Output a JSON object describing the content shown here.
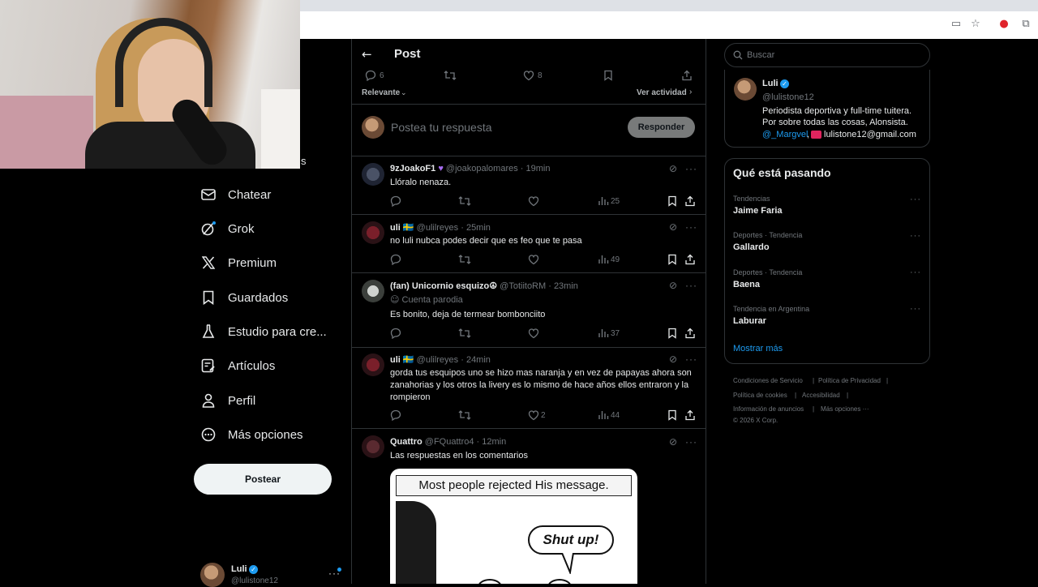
{
  "webcam_label": "s",
  "left_nav": {
    "items": [
      {
        "label": "Chatear",
        "icon": "mail-icon"
      },
      {
        "label": "Grok",
        "icon": "grok-icon"
      },
      {
        "label": "Premium",
        "icon": "x-logo-icon"
      },
      {
        "label": "Guardados",
        "icon": "bookmark-icon"
      },
      {
        "label": "Estudio para cre...",
        "icon": "flask-icon"
      },
      {
        "label": "Artículos",
        "icon": "article-icon"
      },
      {
        "label": "Perfil",
        "icon": "person-icon"
      },
      {
        "label": "Más opciones",
        "icon": "more-circle-icon"
      }
    ],
    "post_button": "Postear",
    "account": {
      "name": "Luli",
      "handle": "@lulistone12"
    }
  },
  "header": {
    "title": "Post"
  },
  "main_actions": {
    "replies": "6",
    "likes": "8"
  },
  "sort": {
    "label": "Relevante",
    "activity": "Ver actividad"
  },
  "composer": {
    "placeholder": "Postea tu respuesta",
    "button": "Responder"
  },
  "replies": [
    {
      "name": "9zJoakoF1",
      "handle": "@joakopalomares · 19min",
      "text": "Llóralo nenaza.",
      "retweets": "",
      "likes": "",
      "views": "25"
    },
    {
      "name": "uli 🇸🇪",
      "handle": "@ulilreyes · 25min",
      "text": "no luli nubca podes decir que es feo que te pasa",
      "retweets": "",
      "likes": "",
      "views": "49"
    },
    {
      "name": "(fan) Unicornio esquizo☮",
      "handle": "@TotiitoRM · 23min",
      "parody": "Cuenta parodia",
      "text": "Es bonito, deja de termear bombonciito",
      "retweets": "",
      "likes": "",
      "views": "37"
    },
    {
      "name": "uli 🇸🇪",
      "handle": "@ulilreyes · 24min",
      "text": "gorda tus esquipos uno se hizo mas naranja y en vez de papayas ahora son zanahorias y los otros la livery es lo mismo de hace años ellos entraron y la rompieron",
      "retweets": "",
      "likes": "2",
      "views": "44"
    },
    {
      "name": "Quattro",
      "handle": "@FQuattro4 · 12min",
      "text": "Las respuestas en los comentarios"
    }
  ],
  "comic": {
    "caption": "Most people rejected His message.",
    "bubble": "Shut up!"
  },
  "right": {
    "search_placeholder": "Buscar",
    "profile": {
      "name": "Luli",
      "handle": "@lulistone12",
      "bio1": "Periodista deportiva y full-time tuitera.",
      "bio2": "Por sobre todas las cosas, Alonsista.",
      "mention": "@_Margvel",
      "email": "lulistone12@gmail.com"
    },
    "trending_title": "Qué está pasando",
    "trends": [
      {
        "category": "Tendencias",
        "name": "Jaime Faria"
      },
      {
        "category": "Deportes · Tendencia",
        "name": "Gallardo"
      },
      {
        "category": "Deportes · Tendencia",
        "name": "Baena"
      },
      {
        "category": "Tendencia en Argentina",
        "name": "Laburar"
      }
    ],
    "show_more": "Mostrar más",
    "footer": [
      "Condiciones de Servicio",
      "Política de Privacidad",
      "Política de cookies",
      "Accesibilidad",
      "Información de anuncios",
      "Más opciones ···",
      "© 2026 X Corp."
    ]
  },
  "colors": {
    "accent": "#1d9bf0",
    "background": "#000000",
    "border": "#2f3336",
    "muted": "#71767b"
  }
}
